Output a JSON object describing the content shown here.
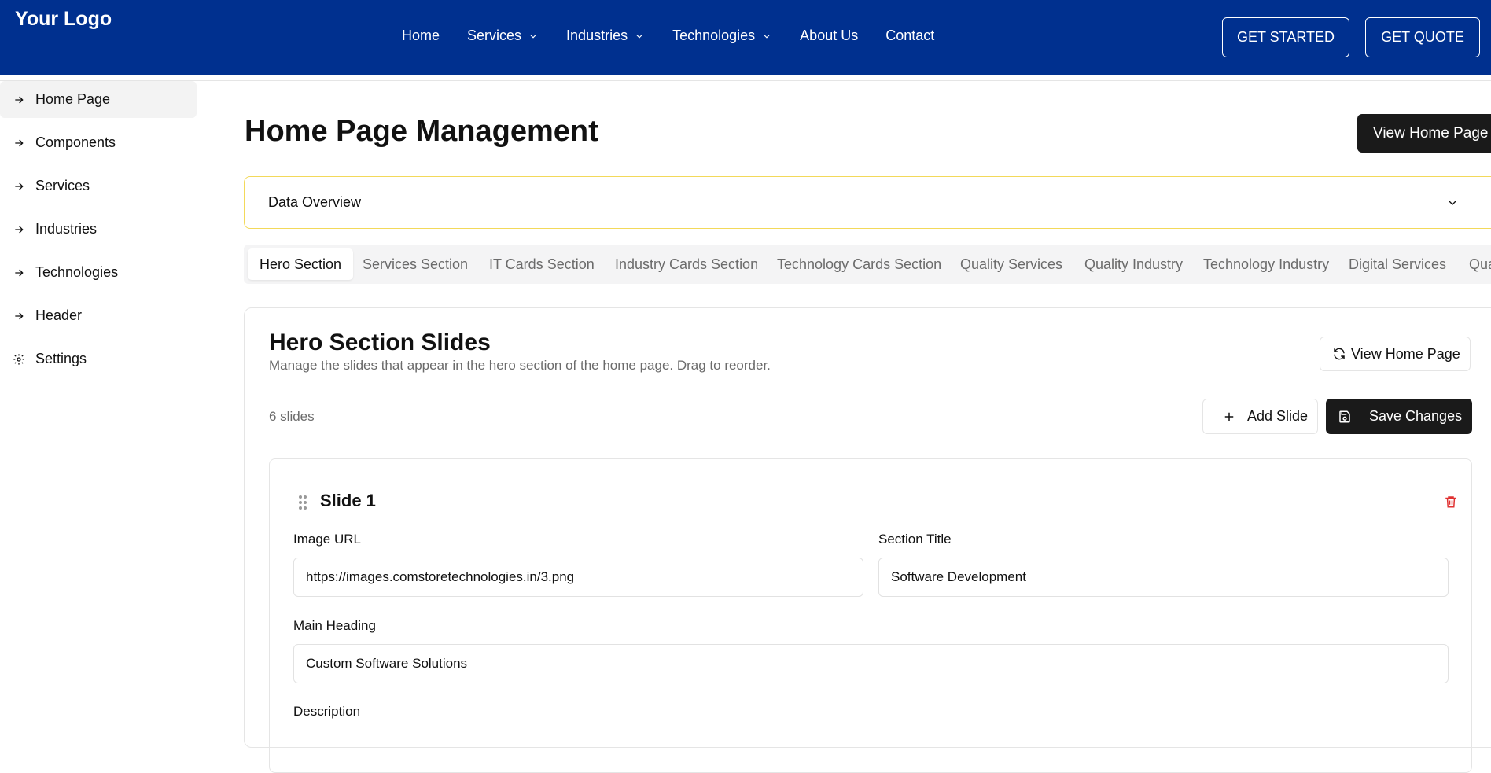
{
  "header": {
    "logo": "Your Logo",
    "nav": [
      {
        "label": "Home",
        "dropdown": false
      },
      {
        "label": "Services",
        "dropdown": true
      },
      {
        "label": "Industries",
        "dropdown": true
      },
      {
        "label": "Technologies",
        "dropdown": true
      },
      {
        "label": "About Us",
        "dropdown": false
      },
      {
        "label": "Contact",
        "dropdown": false
      }
    ],
    "get_started": "GET STARTED",
    "get_quote": "GET QUOTE",
    "bg_color": "#00308f"
  },
  "sidebar": {
    "items": [
      {
        "label": "Home Page",
        "icon": "arrow-right-icon",
        "active": true
      },
      {
        "label": "Components",
        "icon": "arrow-right-icon"
      },
      {
        "label": "Services",
        "icon": "arrow-right-icon"
      },
      {
        "label": "Industries",
        "icon": "arrow-right-icon"
      },
      {
        "label": "Technologies",
        "icon": "arrow-right-icon"
      },
      {
        "label": "Header",
        "icon": "arrow-right-icon"
      },
      {
        "label": "Settings",
        "icon": "gear-icon"
      }
    ]
  },
  "main": {
    "title": "Home Page Management",
    "view_home_button": "View Home Page",
    "overview_label": "Data Overview",
    "tabs": [
      "Hero Section",
      "Services Section",
      "IT Cards Section",
      "Industry Cards Section",
      "Technology Cards Section",
      "Quality Services",
      "Quality Industry",
      "Technology Industry",
      "Digital Services",
      "Qua"
    ],
    "active_tab": 0
  },
  "hero": {
    "title": "Hero Section Slides",
    "description": "Manage the slides that appear in the hero section of the home page. Drag to reorder.",
    "view_home_button": "View Home Page",
    "slides_count": "6 slides",
    "add_slide": "Add Slide",
    "save_changes": "Save Changes",
    "slide": {
      "title": "Slide 1",
      "image_url_label": "Image URL",
      "image_url_value": "https://images.comstoretechnologies.in/3.png",
      "section_title_label": "Section Title",
      "section_title_value": "Software Development",
      "main_heading_label": "Main Heading",
      "main_heading_value": "Custom Software Solutions",
      "description_label": "Description"
    }
  }
}
